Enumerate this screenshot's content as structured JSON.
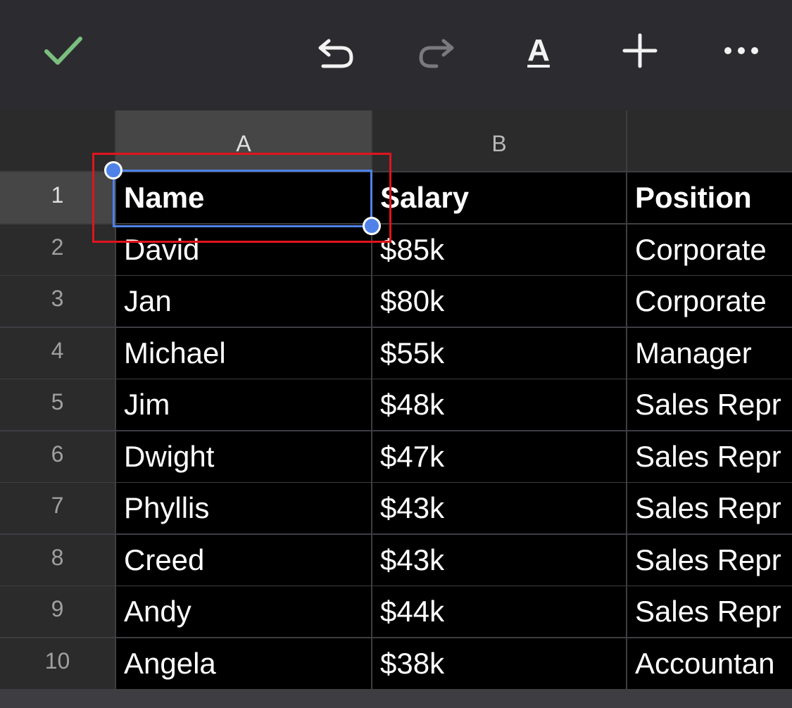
{
  "toolbar": {
    "icons": [
      "check-icon",
      "undo-icon",
      "redo-icon",
      "text-format-icon",
      "plus-icon",
      "more-icon"
    ],
    "format_glyph": "A",
    "accent": "#7bbf7e"
  },
  "sheet": {
    "columns": [
      "A",
      "B",
      ""
    ],
    "selected_column": "A",
    "selected_row": "1",
    "rows": [
      {
        "num": "1",
        "cells": [
          "Name",
          "Salary",
          "Position"
        ]
      },
      {
        "num": "2",
        "cells": [
          "David",
          "$85k",
          "Corporate"
        ]
      },
      {
        "num": "3",
        "cells": [
          "Jan",
          "$80k",
          "Corporate"
        ]
      },
      {
        "num": "4",
        "cells": [
          "Michael",
          "$55k",
          "Manager"
        ]
      },
      {
        "num": "5",
        "cells": [
          "Jim",
          "$48k",
          "Sales Repr"
        ]
      },
      {
        "num": "6",
        "cells": [
          "Dwight",
          "$47k",
          "Sales Repr"
        ]
      },
      {
        "num": "7",
        "cells": [
          "Phyllis",
          "$43k",
          "Sales Repr"
        ]
      },
      {
        "num": "8",
        "cells": [
          "Creed",
          "$43k",
          "Sales Repr"
        ]
      },
      {
        "num": "9",
        "cells": [
          "Andy",
          "$44k",
          "Sales Repr"
        ]
      },
      {
        "num": "10",
        "cells": [
          "Angela",
          "$38k",
          "Accountan"
        ]
      }
    ],
    "selection_color": "#4f82e8",
    "highlight_color": "#e0141c"
  }
}
